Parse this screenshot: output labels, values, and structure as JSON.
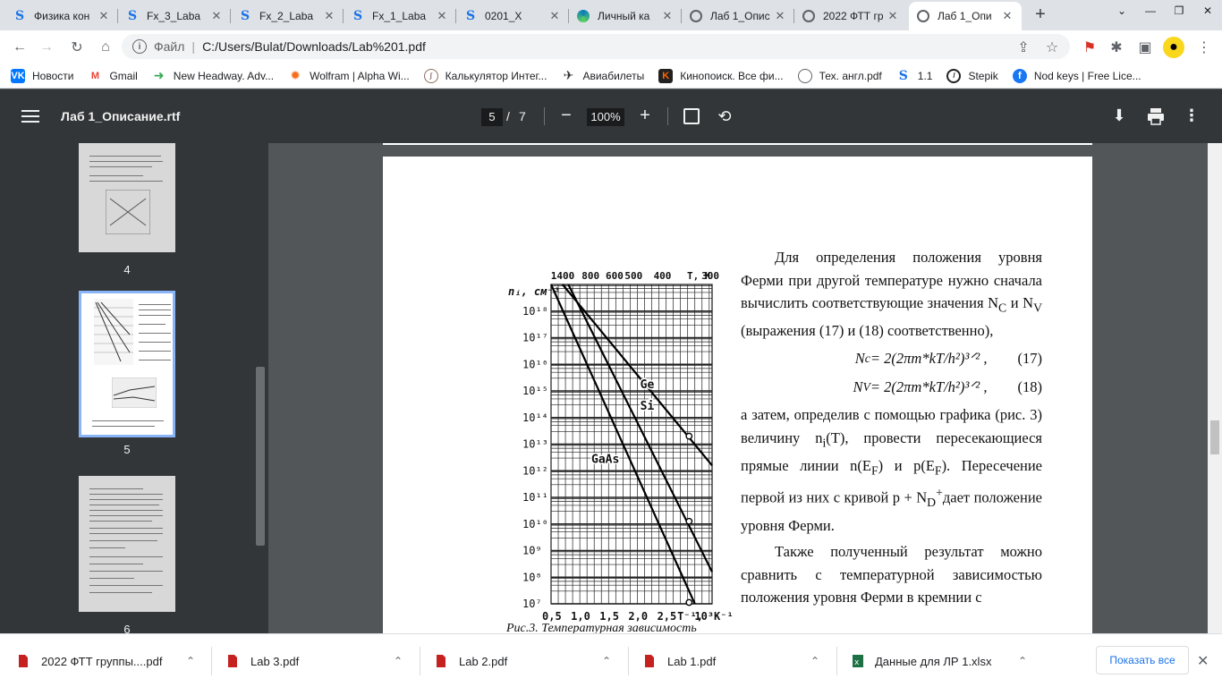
{
  "tabs": [
    {
      "title": "Физика кон",
      "icon": "stepik-icon"
    },
    {
      "title": "Fx_3_Laba",
      "icon": "stepik-icon"
    },
    {
      "title": "Fx_2_Laba",
      "icon": "stepik-icon"
    },
    {
      "title": "Fx_1_Laba",
      "icon": "stepik-icon"
    },
    {
      "title": "0201_X",
      "icon": "stepik-icon"
    },
    {
      "title": "Личный ка",
      "icon": "edge-icon"
    },
    {
      "title": "Лаб 1_Опис",
      "icon": "globe-icon"
    },
    {
      "title": "2022 ФТТ гр",
      "icon": "globe-icon"
    },
    {
      "title": "Лаб 1_Опи",
      "icon": "globe-icon"
    }
  ],
  "new_tab_label": "+",
  "address": {
    "scheme": "Файл",
    "url": "C:/Users/Bulat/Downloads/Lab%201.pdf"
  },
  "bookmarks": [
    {
      "label": "Новости",
      "icon": "vk-icon",
      "color": "#0077ff"
    },
    {
      "label": "Gmail",
      "icon": "gmail-icon",
      "color": "#ea4335"
    },
    {
      "label": "New Headway. Adv...",
      "icon": "arrow-icon",
      "color": "#34a853"
    },
    {
      "label": "Wolfram | Alpha Wi...",
      "icon": "wolfram-icon",
      "color": "#f96c1c"
    },
    {
      "label": "Калькулятор Интег...",
      "icon": "calculator-icon",
      "color": "#8d6e63"
    },
    {
      "label": "Авиабилеты",
      "icon": "plane-icon",
      "color": "#333333"
    },
    {
      "label": "Кинопоиск. Все фи...",
      "icon": "kinopoisk-icon",
      "color": "#ff6600"
    },
    {
      "label": "Тех. англ.pdf",
      "icon": "globe-icon",
      "color": "#5f6368"
    },
    {
      "label": "1.1",
      "icon": "stepik-icon",
      "color": "#1a73e8"
    },
    {
      "label": "Stepik",
      "icon": "stepik-icon",
      "color": "#222222"
    },
    {
      "label": "Nod keys | Free Lice...",
      "icon": "facebook-icon",
      "color": "#1877f2"
    }
  ],
  "pdf": {
    "title": "Лаб 1_Описание.rtf",
    "current_page": "5",
    "page_sep": "/",
    "total_pages": "7",
    "zoom": "100%"
  },
  "thumbnails": [
    {
      "label": "4"
    },
    {
      "label": "5"
    },
    {
      "label": "6"
    }
  ],
  "page_content": {
    "para1": "Для определения положения уровня Ферми при другой температуре нужно сначала вычислить соответствующие значения N",
    "para1_sub1": "C",
    "para1_mid": " и N",
    "para1_sub2": "V",
    "para1_end": " (выражения (17) и (18) соответственно),",
    "formula1_lhs": "N",
    "formula1_sub": "c",
    "formula1_rhs": " = 2(2πm*kT/h²)³ᐟ² ,",
    "formula1_num": "(17)",
    "formula2_lhs": "N",
    "formula2_sub": "V",
    "formula2_rhs": " = 2(2πm*kT/h²)³ᐟ² ,",
    "formula2_num": "(18)",
    "para2": "а затем, определив с помощью графика (рис. 3) величину n",
    "para2_sub": "i",
    "para2_b": "(T), провести пересекающиеся прямые линии n(E",
    "para2_sub2": "F",
    "para2_c": ") и p(E",
    "para2_sub3": "F",
    "para2_d": "). Пересечение первой из них с кривой p + N",
    "para2_sub4": "D",
    "para2_sup4": "+",
    "para2_e": "дает положение уровня Ферми.",
    "para3": "Также полученный результат можно сравнить с температурной зависимостью положения уровня Ферми в кремнии с",
    "caption": "Рис.3. Температурная зависимость"
  },
  "chart_data": {
    "type": "line",
    "title": "",
    "xlabel": "T⁻¹, 10³ K⁻¹",
    "ylabel": "nᵢ, см⁻³",
    "top_axis_label": "T, K",
    "top_ticks": [
      "1400",
      "800",
      "600",
      "500",
      "400",
      "300"
    ],
    "x_ticks": [
      "0,5",
      "1,0",
      "1,5",
      "2,0",
      "2,5",
      "T⁻¹,",
      "10³K⁻¹"
    ],
    "y_ticks": [
      "10⁷",
      "10⁸",
      "10⁹",
      "10¹⁰",
      "10¹¹",
      "10¹²",
      "10¹³",
      "10¹⁴",
      "10¹⁵",
      "10¹⁶",
      "10¹⁷",
      "10¹⁸"
    ],
    "xlim": [
      0.5,
      3.3
    ],
    "ylim_log10": [
      7,
      19
    ],
    "series": [
      {
        "name": "Ge",
        "x": [
          0.7,
          3.3
        ],
        "log10_y": [
          19,
          12.2
        ]
      },
      {
        "name": "Si",
        "x": [
          0.8,
          3.3
        ],
        "log10_y": [
          19,
          8.2
        ]
      },
      {
        "name": "GaAs",
        "x": [
          0.5,
          3.0
        ],
        "log10_y": [
          19,
          7.0
        ]
      }
    ]
  },
  "downloads": [
    {
      "name": "2022 ФТТ группы....pdf"
    },
    {
      "name": "Lab 3.pdf"
    },
    {
      "name": "Lab 2.pdf"
    },
    {
      "name": "Lab 1.pdf"
    },
    {
      "name": "Данные для ЛР 1.xlsx"
    }
  ],
  "show_all_label": "Показать все"
}
